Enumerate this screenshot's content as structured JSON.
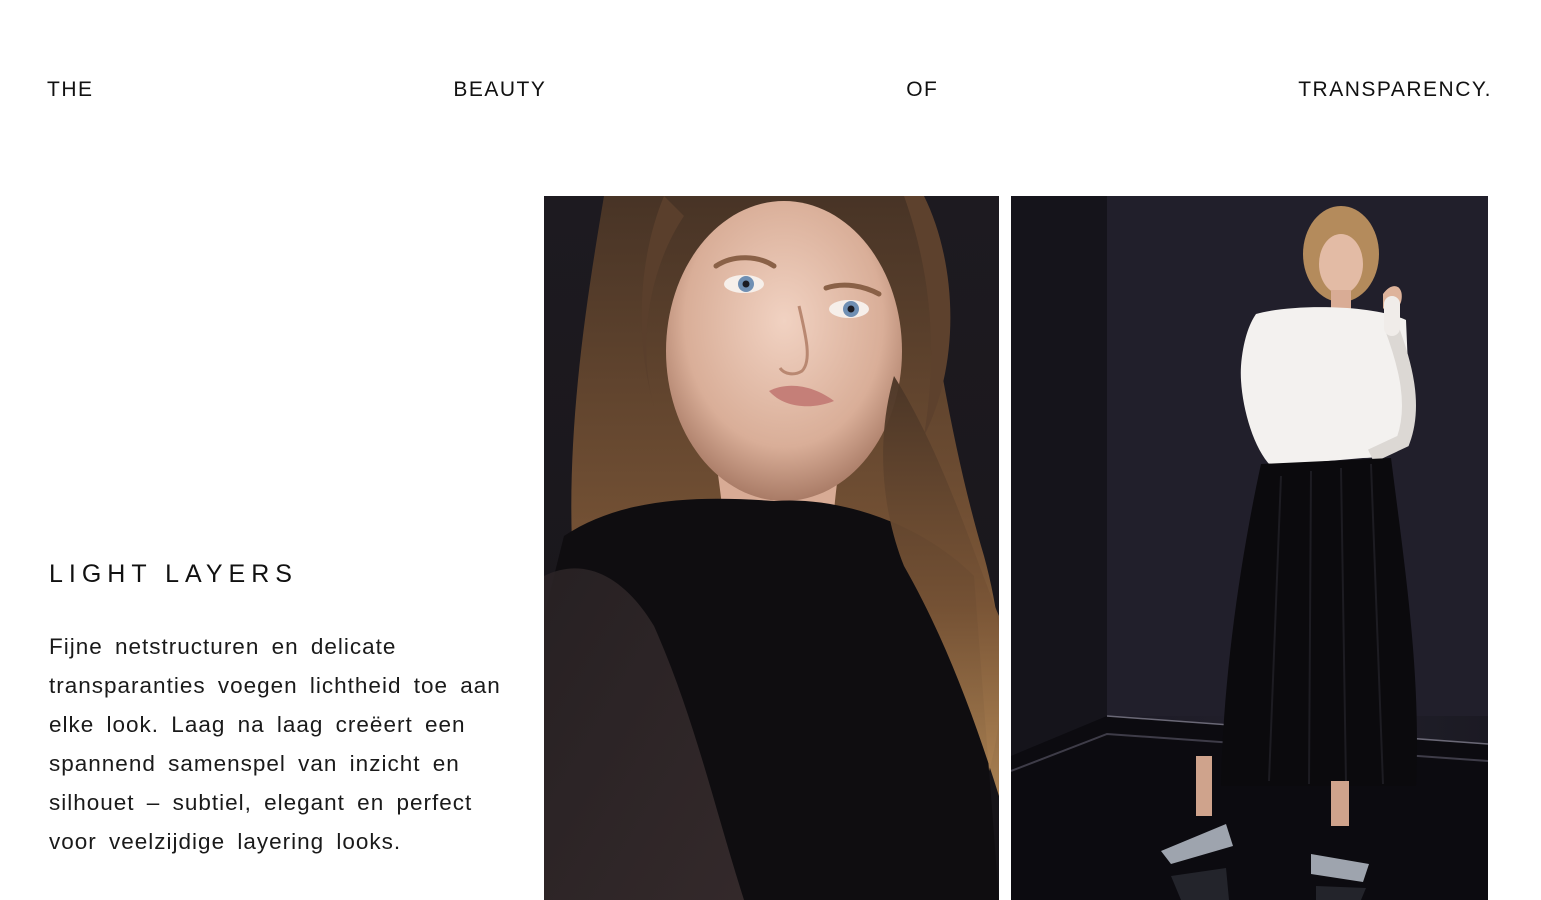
{
  "headline": {
    "words": [
      "THE",
      "BEAUTY",
      "OF",
      "TRANSPARENCY."
    ]
  },
  "section": {
    "title": "LIGHT LAYERS",
    "body": "Fijne netstructuren en delicate transparanties voegen lichtheid toe aan elke look. Laag na laag creëert een spannend samenspel van inzicht en silhouet – subtiel, elegant en perfect voor veelzijdige layering looks."
  },
  "colors": {
    "background": "#ffffff",
    "text": "#111111",
    "photo_backdrop": "#1c1a21"
  }
}
